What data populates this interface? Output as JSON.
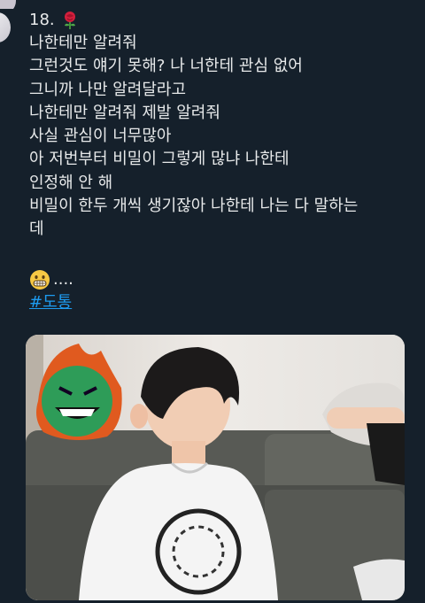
{
  "tweet": {
    "number": "18.",
    "number_icon": "rose-icon",
    "lines": [
      "나한테만 알려줘",
      "그런것도 얘기 못해? 나 너한테 관심 없어",
      "그니까 나만 알려달라고",
      "나한테만 알려줘 제발 알려줘",
      "사실 관심이 너무많아",
      "아 저번부터 비밀이 그렇게 많냐 나한테",
      "인정해 안 해",
      "비밀이 한두 개씩 생기잖아 나한테 나는 다 말하는",
      "데"
    ],
    "emoji_icon": "grimacing-face-icon",
    "ellipsis": "....",
    "hashtag": "#도통"
  },
  "colors": {
    "background": "#15202b",
    "text": "#e7e9ea",
    "link": "#1d9bf0"
  },
  "media": {
    "type": "video-still",
    "description_icon": "media-thumbnail"
  }
}
